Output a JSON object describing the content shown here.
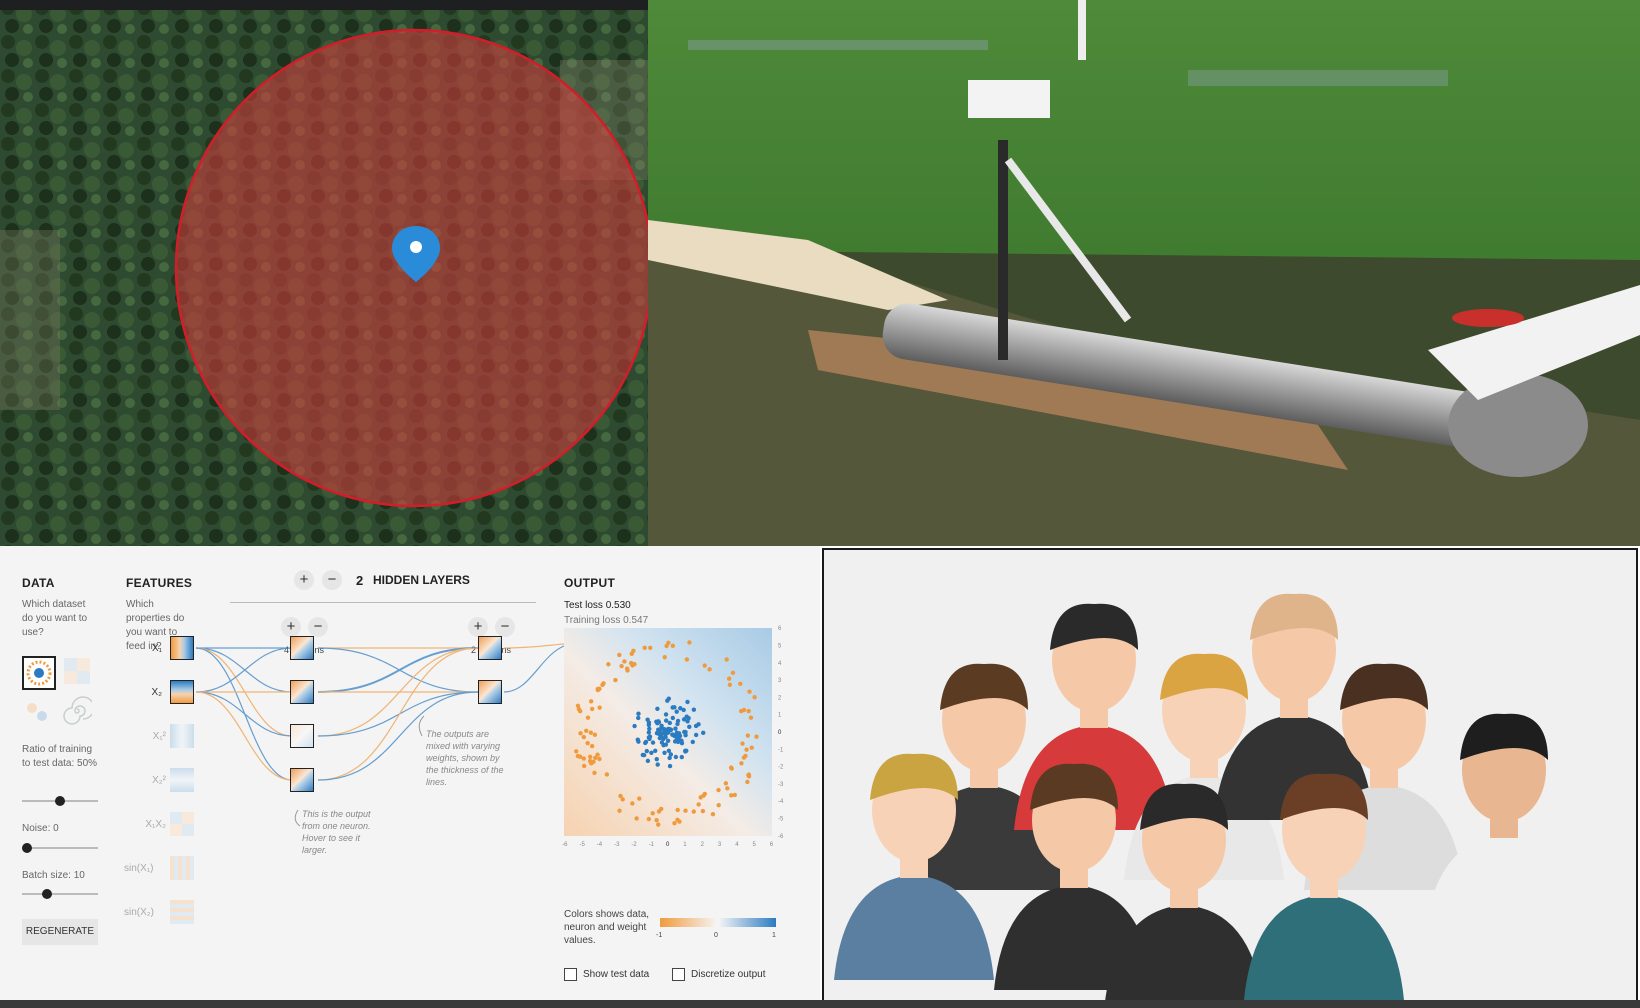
{
  "playground": {
    "data": {
      "heading": "DATA",
      "question": "Which dataset do you want to use?",
      "ratio_label": "Ratio of training to test data:",
      "ratio_value": "50%",
      "ratio_fraction": 0.5,
      "noise_label": "Noise:",
      "noise_value": "0",
      "noise_fraction": 0,
      "batch_label": "Batch size:",
      "batch_value": "10",
      "batch_fraction": 0.3,
      "regenerate_label": "REGENERATE"
    },
    "features": {
      "heading": "FEATURES",
      "question": "Which properties do you want to feed in?",
      "items": [
        "X₁",
        "X₂",
        "X₁²",
        "X₂²",
        "X₁X₂",
        "sin(X₁)",
        "sin(X₂)"
      ]
    },
    "hidden": {
      "plus": "+",
      "minus": "−",
      "count": "2",
      "label": "HIDDEN LAYERS",
      "layer1_neurons": "4 neurons",
      "layer2_neurons": "2 neurons"
    },
    "notes": {
      "neuron_note": "This is the output from one neuron. Hover to see it larger.",
      "weights_note": "The outputs are mixed with varying weights, shown by the thickness of the lines."
    },
    "output": {
      "heading": "OUTPUT",
      "test_loss_label": "Test loss",
      "test_loss": "0.530",
      "train_loss_label": "Training loss",
      "train_loss": "0.547",
      "colors_note": "Colors shows data, neuron and weight values.",
      "scale_min": "-1",
      "scale_mid": "0",
      "scale_max": "1",
      "show_test_label": "Show test data",
      "discretize_label": "Discretize output",
      "axis_ticks": [
        "-6",
        "-5",
        "-4",
        "-3",
        "-2",
        "-1",
        "0",
        "1",
        "2",
        "3",
        "4",
        "5",
        "6"
      ]
    },
    "colors": {
      "orange": "#f09a3e",
      "blue": "#2b7bc1"
    }
  }
}
